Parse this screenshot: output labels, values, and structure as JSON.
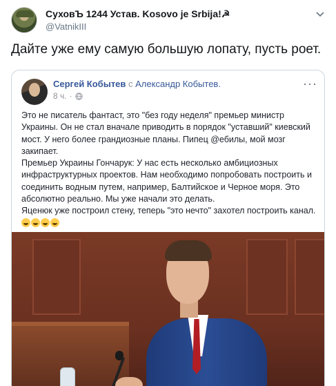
{
  "tweet": {
    "author_name": "СуховЪ 1244 Устав. Kosovo je Srbija!☭",
    "handle": "@VatnikIII",
    "text": "Дайте уже ему самую большую лопату, пусть роет."
  },
  "embedded_post": {
    "author": "Сергей Кобытев",
    "with_word": " с ",
    "with_name": "Александр Кобытев.",
    "time": "8 ч.",
    "dot": "·",
    "more": "···",
    "paragraphs": [
      "Это не писатель фантаст, это \"без году неделя\" премьер министр Украины. Он не стал вначале приводить в порядок \"уставший\" киевский мост. У него более грандиозные планы. Пипец @ебилы, мой мозг закипает.",
      "Премьер Украины Гончарук: У нас есть несколько амбициозных инфраструктурных проектов. Нам необходимо попробовать построить и соединить водным путем, например, Балтийское и Черное моря. Это абсолютно реально. Мы уже начали это делать.",
      "Яценюк уже построил стену, теперь \"это нечто\" захотел построить канал."
    ]
  },
  "icons": {
    "caret": "chevron-down-icon",
    "globe": "globe-icon",
    "more": "more-horizontal-icon",
    "emoji": "laughing-emoji-icon"
  },
  "colors": {
    "fb_link": "#365899",
    "handle": "#657786",
    "border": "#ccd6dd"
  }
}
